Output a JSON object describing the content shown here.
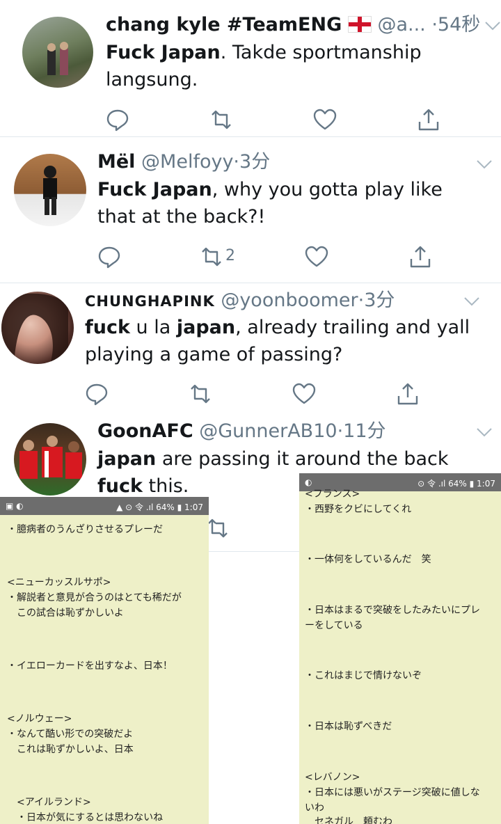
{
  "tweets": [
    {
      "name": "chang kyle #TeamENG",
      "handle": "@a...",
      "time": "54秒",
      "text_bold": "Fuck Japan",
      "text_rest": ". Takde sportmanship",
      "text_line2": "langsung.",
      "retweets": "",
      "avatar_icon": "profile-photo-couple"
    },
    {
      "name": "Mël",
      "handle": "@Melfoyy",
      "time": "3分",
      "text_bold": "Fuck Japan",
      "text_rest": ", why you gotta play like",
      "text_line2": "that at the back?!",
      "retweets": "2",
      "avatar_icon": "profile-photo-person"
    },
    {
      "name": "CHUNGHAPINK",
      "handle": "@yoonboomer",
      "time": "3分",
      "text_a": "fuck",
      "text_b": " u la ",
      "text_c": "japan",
      "text_d": ", already trailing and yall",
      "text_line2": "playing a game of passing?",
      "avatar_icon": "profile-photo-woman"
    },
    {
      "name": "GoonAFC",
      "handle": "@GunnerAB10",
      "time": "11分",
      "text_bold": "japan",
      "text_rest": " are passing it around the back",
      "text_bold2": "fuck",
      "text_rest2": " this.",
      "avatar_icon": "profile-photo-football"
    }
  ],
  "sep": "·",
  "panel_left": {
    "status": "▲ ⊙ 令 .ıl 64% ▮ 1:07",
    "lines": [
      "・臆病者のうんざりさせるプレーだ",
      "<ニューカッスルサポ>",
      "・解説者と意見が合うのはとても稀だが",
      "　この試合は恥ずかしいよ",
      "・イエローカードを出すなよ、日本！",
      "<ノルウェー>",
      "・なんて酷い形での突破だよ",
      "　これは恥ずかしいよ、日本",
      "　<アイルランド>",
      "　・日本が気にするとは思わないね"
    ]
  },
  "panel_right": {
    "status": "⊙ 令 .ıl 64% ▮ 1:07",
    "lines": [
      "<フランス>",
      "・西野をクビにしてくれ",
      "・一体何をしているんだ　笑",
      "・日本はまるで突破をしたみたいにプレ",
      "ーをしている",
      "・これはまじで情けないぞ",
      "・日本は恥ずべきだ",
      "<レバノン>",
      "・日本には悪いがステージ突破に値しな",
      "いわ",
      "　セネガル　頼むわ"
    ]
  },
  "colors": {
    "text": "#14171a",
    "muted": "#657786",
    "panel": "#eef0c8"
  }
}
